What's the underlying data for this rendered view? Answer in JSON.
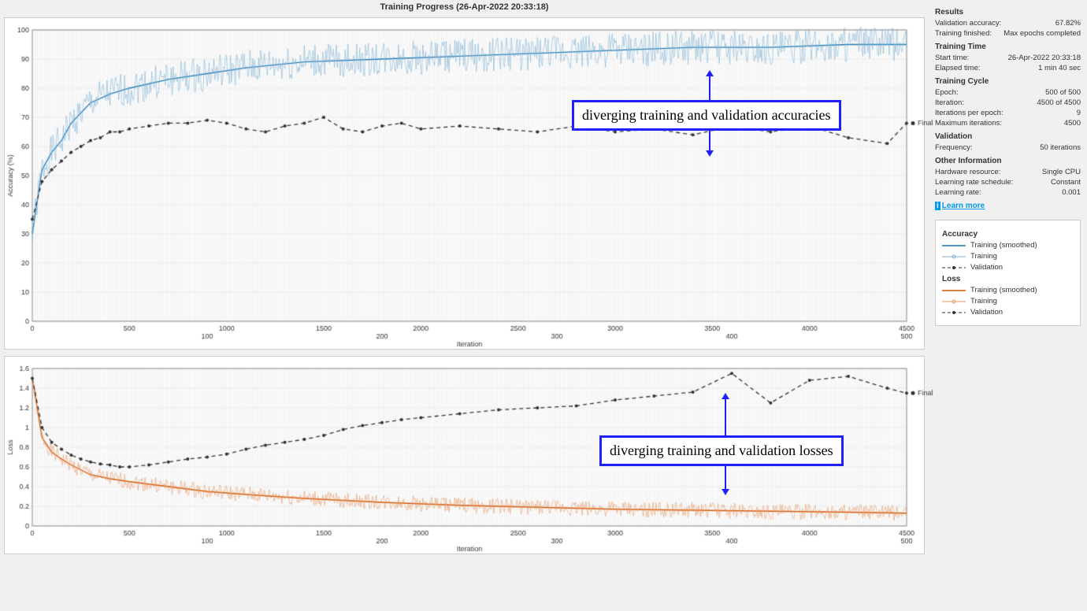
{
  "title": "Training Progress (26-Apr-2022 20:33:18)",
  "annot_acc": "diverging training and validation accuracies",
  "annot_loss": "diverging training and validation losses",
  "final_label": "Final",
  "sidebar": {
    "results_h": "Results",
    "val_acc_k": "Validation accuracy:",
    "val_acc_v": "67.82%",
    "train_fin_k": "Training finished:",
    "train_fin_v": "Max epochs completed",
    "time_h": "Training Time",
    "start_k": "Start time:",
    "start_v": "26-Apr-2022 20:33:18",
    "elapsed_k": "Elapsed time:",
    "elapsed_v": "1 min 40 sec",
    "cycle_h": "Training Cycle",
    "epoch_k": "Epoch:",
    "epoch_v": "500 of 500",
    "iter_k": "Iteration:",
    "iter_v": "4500 of 4500",
    "ipe_k": "Iterations per epoch:",
    "ipe_v": "9",
    "maxiter_k": "Maximum iterations:",
    "maxiter_v": "4500",
    "val_h": "Validation",
    "freq_k": "Frequency:",
    "freq_v": "50 iterations",
    "other_h": "Other Information",
    "hw_k": "Hardware resource:",
    "hw_v": "Single CPU",
    "lrs_k": "Learning rate schedule:",
    "lrs_v": "Constant",
    "lr_k": "Learning rate:",
    "lr_v": "0.001",
    "learn": "Learn more"
  },
  "legend": {
    "acc_h": "Accuracy",
    "train_smooth": "Training (smoothed)",
    "train": "Training",
    "validation": "Validation",
    "loss_h": "Loss"
  },
  "chart_data": [
    {
      "type": "line",
      "title": "Accuracy",
      "xlabel": "Iteration",
      "ylabel": "Accuracy (%)",
      "xlim": [
        0,
        4500
      ],
      "ylim": [
        0,
        100
      ],
      "epoch_ticks": [
        100,
        200,
        300,
        400,
        500
      ],
      "x_ticks": [
        0,
        500,
        1000,
        1500,
        2000,
        2500,
        3000,
        3500,
        4000,
        4500
      ],
      "y_ticks": [
        0,
        10,
        20,
        30,
        40,
        50,
        60,
        70,
        80,
        90,
        100
      ],
      "series": [
        {
          "name": "Training (smoothed)",
          "color": "#1f77b4",
          "x": [
            0,
            50,
            100,
            150,
            200,
            300,
            400,
            500,
            700,
            900,
            1100,
            1400,
            1800,
            2200,
            2600,
            3000,
            3400,
            3800,
            4200,
            4500
          ],
          "y": [
            30,
            52,
            58,
            62,
            68,
            75,
            78,
            80,
            83,
            85,
            87,
            89,
            90,
            91,
            92,
            93,
            94,
            94,
            95,
            95
          ]
        },
        {
          "name": "Training",
          "color": "#7fb3d5",
          "noisy": true,
          "amp": 6,
          "x": [
            0,
            50,
            100,
            150,
            200,
            300,
            400,
            500,
            700,
            900,
            1100,
            1400,
            1800,
            2200,
            2600,
            3000,
            3400,
            3800,
            4200,
            4500
          ],
          "y": [
            30,
            52,
            58,
            62,
            68,
            75,
            78,
            80,
            83,
            85,
            87,
            89,
            90,
            91,
            92,
            93,
            94,
            94,
            95,
            95
          ]
        },
        {
          "name": "Validation",
          "color": "#333",
          "dashed": true,
          "markers": true,
          "x": [
            0,
            50,
            100,
            150,
            200,
            250,
            300,
            350,
            400,
            450,
            500,
            600,
            700,
            800,
            900,
            1000,
            1100,
            1200,
            1300,
            1400,
            1500,
            1600,
            1700,
            1800,
            1900,
            2000,
            2200,
            2400,
            2600,
            2800,
            3000,
            3200,
            3400,
            3600,
            3800,
            4000,
            4200,
            4400,
            4500
          ],
          "y": [
            35,
            48,
            52,
            55,
            58,
            60,
            62,
            63,
            65,
            65,
            66,
            67,
            68,
            68,
            69,
            68,
            66,
            65,
            67,
            68,
            70,
            66,
            65,
            67,
            68,
            66,
            67,
            66,
            65,
            67,
            65,
            66,
            64,
            67,
            65,
            67,
            63,
            61,
            68
          ]
        }
      ]
    },
    {
      "type": "line",
      "title": "Loss",
      "xlabel": "Iteration",
      "ylabel": "Loss",
      "xlim": [
        0,
        4500
      ],
      "ylim": [
        0,
        1.6
      ],
      "epoch_ticks": [
        100,
        200,
        300,
        400,
        500
      ],
      "x_ticks": [
        0,
        500,
        1000,
        1500,
        2000,
        2500,
        3000,
        3500,
        4000,
        4500
      ],
      "y_ticks": [
        0,
        0.2,
        0.4,
        0.6,
        0.8,
        1.0,
        1.2,
        1.4,
        1.6
      ],
      "series": [
        {
          "name": "Training (smoothed)",
          "color": "#d35400",
          "x": [
            0,
            50,
            100,
            150,
            200,
            300,
            400,
            500,
            700,
            900,
            1100,
            1400,
            1800,
            2200,
            2600,
            3000,
            3400,
            3800,
            4200,
            4500
          ],
          "y": [
            1.5,
            0.9,
            0.75,
            0.68,
            0.62,
            0.52,
            0.48,
            0.45,
            0.4,
            0.35,
            0.32,
            0.28,
            0.24,
            0.21,
            0.19,
            0.17,
            0.16,
            0.15,
            0.14,
            0.13
          ]
        },
        {
          "name": "Training",
          "color": "#e59866",
          "noisy": true,
          "amp": 0.08,
          "x": [
            0,
            50,
            100,
            150,
            200,
            300,
            400,
            500,
            700,
            900,
            1100,
            1400,
            1800,
            2200,
            2600,
            3000,
            3400,
            3800,
            4200,
            4500
          ],
          "y": [
            1.5,
            0.9,
            0.75,
            0.68,
            0.62,
            0.52,
            0.48,
            0.45,
            0.4,
            0.35,
            0.32,
            0.28,
            0.24,
            0.21,
            0.19,
            0.17,
            0.16,
            0.15,
            0.14,
            0.13
          ]
        },
        {
          "name": "Validation",
          "color": "#333",
          "dashed": true,
          "markers": true,
          "x": [
            0,
            50,
            100,
            150,
            200,
            250,
            300,
            350,
            400,
            450,
            500,
            600,
            700,
            800,
            900,
            1000,
            1100,
            1200,
            1300,
            1400,
            1500,
            1600,
            1700,
            1800,
            1900,
            2000,
            2200,
            2400,
            2600,
            2800,
            3000,
            3200,
            3400,
            3600,
            3800,
            4000,
            4200,
            4400,
            4500
          ],
          "y": [
            1.5,
            1.0,
            0.85,
            0.78,
            0.72,
            0.68,
            0.65,
            0.63,
            0.62,
            0.6,
            0.6,
            0.62,
            0.65,
            0.68,
            0.7,
            0.73,
            0.78,
            0.82,
            0.85,
            0.88,
            0.92,
            0.98,
            1.02,
            1.05,
            1.08,
            1.1,
            1.14,
            1.18,
            1.2,
            1.22,
            1.28,
            1.32,
            1.36,
            1.55,
            1.25,
            1.48,
            1.52,
            1.4,
            1.35
          ]
        }
      ]
    }
  ]
}
